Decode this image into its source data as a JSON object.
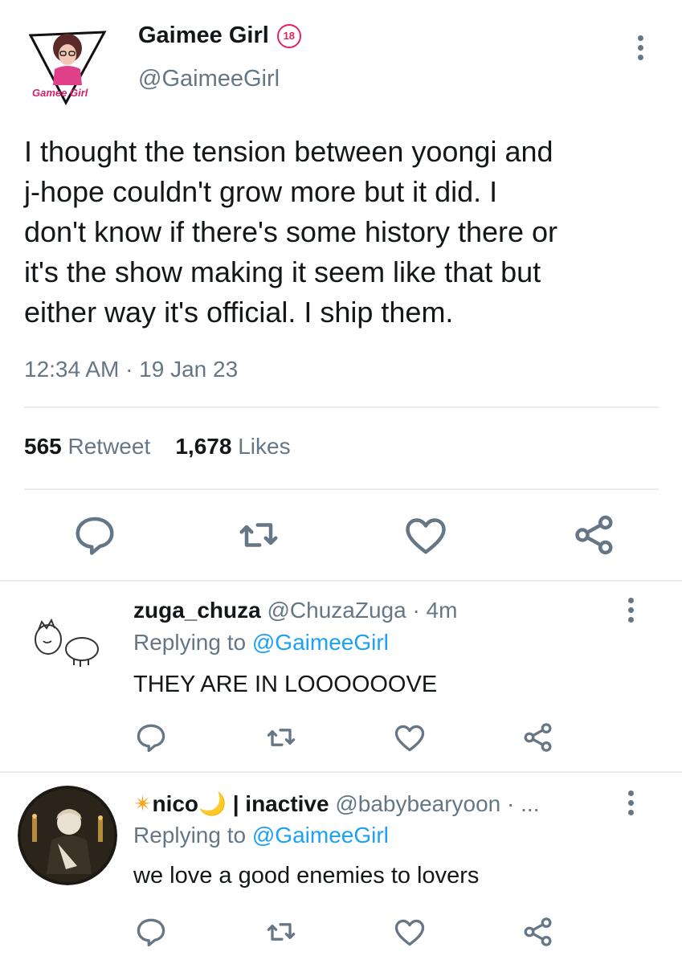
{
  "tweet": {
    "author_name": "Gaimee Girl",
    "badge": "18",
    "handle": "@GaimeeGirl",
    "avatar_caption": "Gamee Girl",
    "lines": [
      "I thought the tension between yoongi and",
      "j-hope couldn't grow more but it did. I",
      "don't know if there's some history there or",
      "it's the show making it seem like that but",
      "either way it's official. I ship them."
    ],
    "timestamp": "12:34 AM · 19 Jan 23",
    "retweets": "565",
    "retweets_label": "Retweet",
    "likes": "1,678",
    "likes_label": "Likes"
  },
  "replies": [
    {
      "name": "zuga_chuza",
      "handle": "@ChuzaZuga · 4m",
      "replying_prefix": "Replying to",
      "replying_to": "@GaimeeGirl",
      "text": "THEY ARE IN LOOOOOOVE"
    },
    {
      "name_prefix": "✴",
      "name": "nico",
      "name_suffix": "🌙",
      "name_extra": "| inactive",
      "handle": "@babybearyoon · ...",
      "replying_prefix": "Replying to",
      "replying_to": "@GaimeeGirl",
      "text": "we love a good enemies to lovers"
    }
  ],
  "icons": [
    "reply-icon",
    "retweet-icon",
    "like-icon",
    "share-icon",
    "more-icon"
  ],
  "colors": {
    "text": "#14171a",
    "secondary": "#657786",
    "link": "#1da1f2",
    "badge": "#e0245e",
    "divider": "#e6ecf0",
    "avatar_pink": "#e0408a",
    "sun": "#f5a623",
    "moon": "#f7c948"
  }
}
